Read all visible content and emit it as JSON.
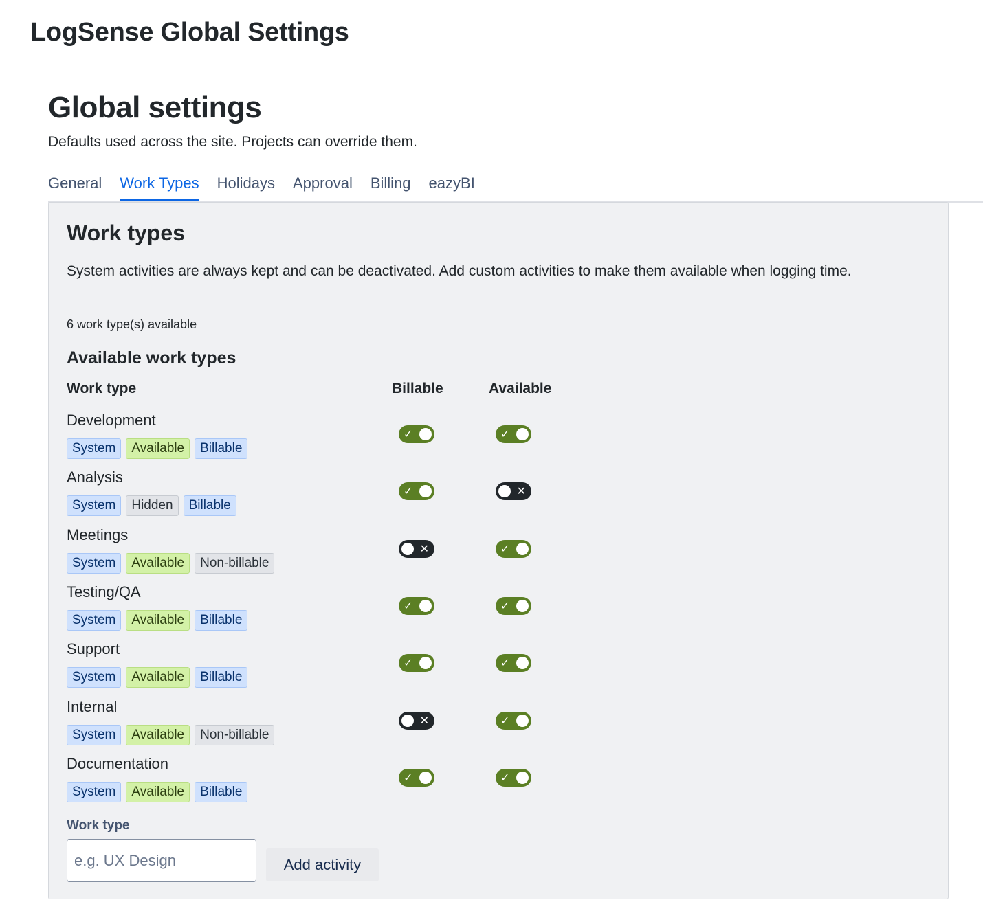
{
  "app": {
    "title": "LogSense Global Settings"
  },
  "page": {
    "title": "Global settings",
    "subtitle": "Defaults used across the site. Projects can override them."
  },
  "tabs": [
    {
      "label": "General",
      "active": false
    },
    {
      "label": "Work Types",
      "active": true
    },
    {
      "label": "Holidays",
      "active": false
    },
    {
      "label": "Approval",
      "active": false
    },
    {
      "label": "Billing",
      "active": false
    },
    {
      "label": "eazyBI",
      "active": false
    }
  ],
  "panel": {
    "title": "Work types",
    "description": "System activities are always kept and can be deactivated. Add custom activities to make them available when logging time.",
    "count_text": "6 work type(s) available",
    "section_title": "Available work types",
    "columns": {
      "work_type": "Work type",
      "billable": "Billable",
      "available": "Available"
    }
  },
  "work_types": [
    {
      "name": "Development",
      "badges": [
        {
          "text": "System",
          "tone": "blue"
        },
        {
          "text": "Available",
          "tone": "green"
        },
        {
          "text": "Billable",
          "tone": "blue"
        }
      ],
      "billable": true,
      "available": true
    },
    {
      "name": "Analysis",
      "badges": [
        {
          "text": "System",
          "tone": "blue"
        },
        {
          "text": "Hidden",
          "tone": "gray"
        },
        {
          "text": "Billable",
          "tone": "blue"
        }
      ],
      "billable": true,
      "available": false
    },
    {
      "name": "Meetings",
      "badges": [
        {
          "text": "System",
          "tone": "blue"
        },
        {
          "text": "Available",
          "tone": "green"
        },
        {
          "text": "Non-billable",
          "tone": "gray"
        }
      ],
      "billable": false,
      "available": true
    },
    {
      "name": "Testing/QA",
      "badges": [
        {
          "text": "System",
          "tone": "blue"
        },
        {
          "text": "Available",
          "tone": "green"
        },
        {
          "text": "Billable",
          "tone": "blue"
        }
      ],
      "billable": true,
      "available": true
    },
    {
      "name": "Support",
      "badges": [
        {
          "text": "System",
          "tone": "blue"
        },
        {
          "text": "Available",
          "tone": "green"
        },
        {
          "text": "Billable",
          "tone": "blue"
        }
      ],
      "billable": true,
      "available": true
    },
    {
      "name": "Internal",
      "badges": [
        {
          "text": "System",
          "tone": "blue"
        },
        {
          "text": "Available",
          "tone": "green"
        },
        {
          "text": "Non-billable",
          "tone": "gray"
        }
      ],
      "billable": false,
      "available": true
    },
    {
      "name": "Documentation",
      "badges": [
        {
          "text": "System",
          "tone": "blue"
        },
        {
          "text": "Available",
          "tone": "green"
        },
        {
          "text": "Billable",
          "tone": "blue"
        }
      ],
      "billable": true,
      "available": true
    }
  ],
  "toggle_icons": {
    "on": "check-icon",
    "off": "x-icon"
  },
  "add_form": {
    "label": "Work type",
    "placeholder": "e.g. UX Design",
    "value": "",
    "button_label": "Add activity"
  },
  "colors": {
    "accent": "#0c66e4",
    "toggle_on": "#5b7f24",
    "toggle_off": "#22272b",
    "badge_blue": "#cfe1fd",
    "badge_green": "#d3f1a7",
    "badge_gray": "#e2e4e8"
  }
}
